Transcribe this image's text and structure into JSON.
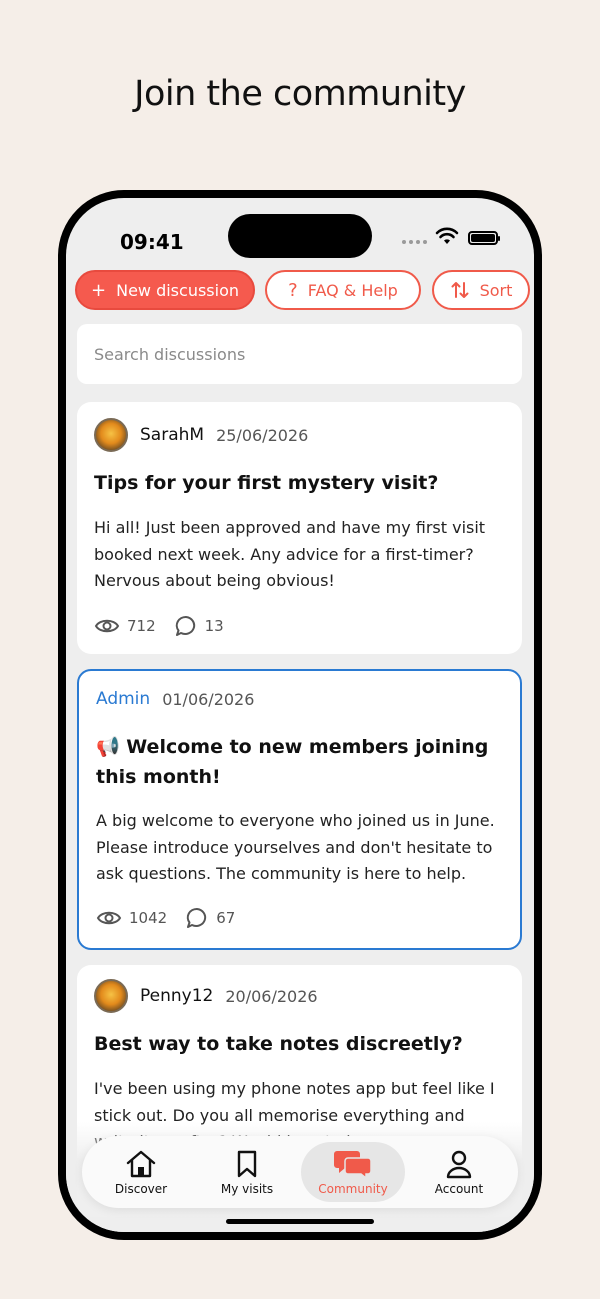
{
  "headline": "Join the community",
  "status_bar": {
    "time": "09:41"
  },
  "toolbar": {
    "new_discussion_label": "New discussion",
    "faq_label": "FAQ & Help",
    "sort_label": "Sort"
  },
  "search": {
    "placeholder": "Search discussions",
    "value": ""
  },
  "posts": [
    {
      "author": "SarahM",
      "date": "25/06/2026",
      "title": "Tips for your first mystery visit?",
      "body": "Hi all! Just been approved and have my first visit booked next week. Any advice for a first-timer? Nervous about being obvious!",
      "views": "712",
      "comments": "13"
    },
    {
      "author": "Admin",
      "date": "01/06/2026",
      "title": "📢 Welcome to new members joining this month!",
      "body": "A big welcome to everyone who joined us in June. Please introduce yourselves and don't hesitate to ask questions. The community is here to help.",
      "views": "1042",
      "comments": "67"
    },
    {
      "author": "Penny12",
      "date": "20/06/2026",
      "title": "Best way to take notes discreetly?",
      "body": "I've been using my phone notes app but feel like I stick out. Do you all memorise everything and write it up after? Would love to know your methods."
    }
  ],
  "tabs": [
    {
      "label": "Discover",
      "icon": "home-icon",
      "active": false
    },
    {
      "label": "My visits",
      "icon": "bookmark-icon",
      "active": false
    },
    {
      "label": "Community",
      "icon": "chat-bubbles-icon",
      "active": true
    },
    {
      "label": "Account",
      "icon": "person-icon",
      "active": false
    }
  ],
  "colors": {
    "background": "#f5eee8",
    "accent": "#f05a4a",
    "admin_blue": "#2a7ad2",
    "screen_bg": "#eeeeee"
  }
}
